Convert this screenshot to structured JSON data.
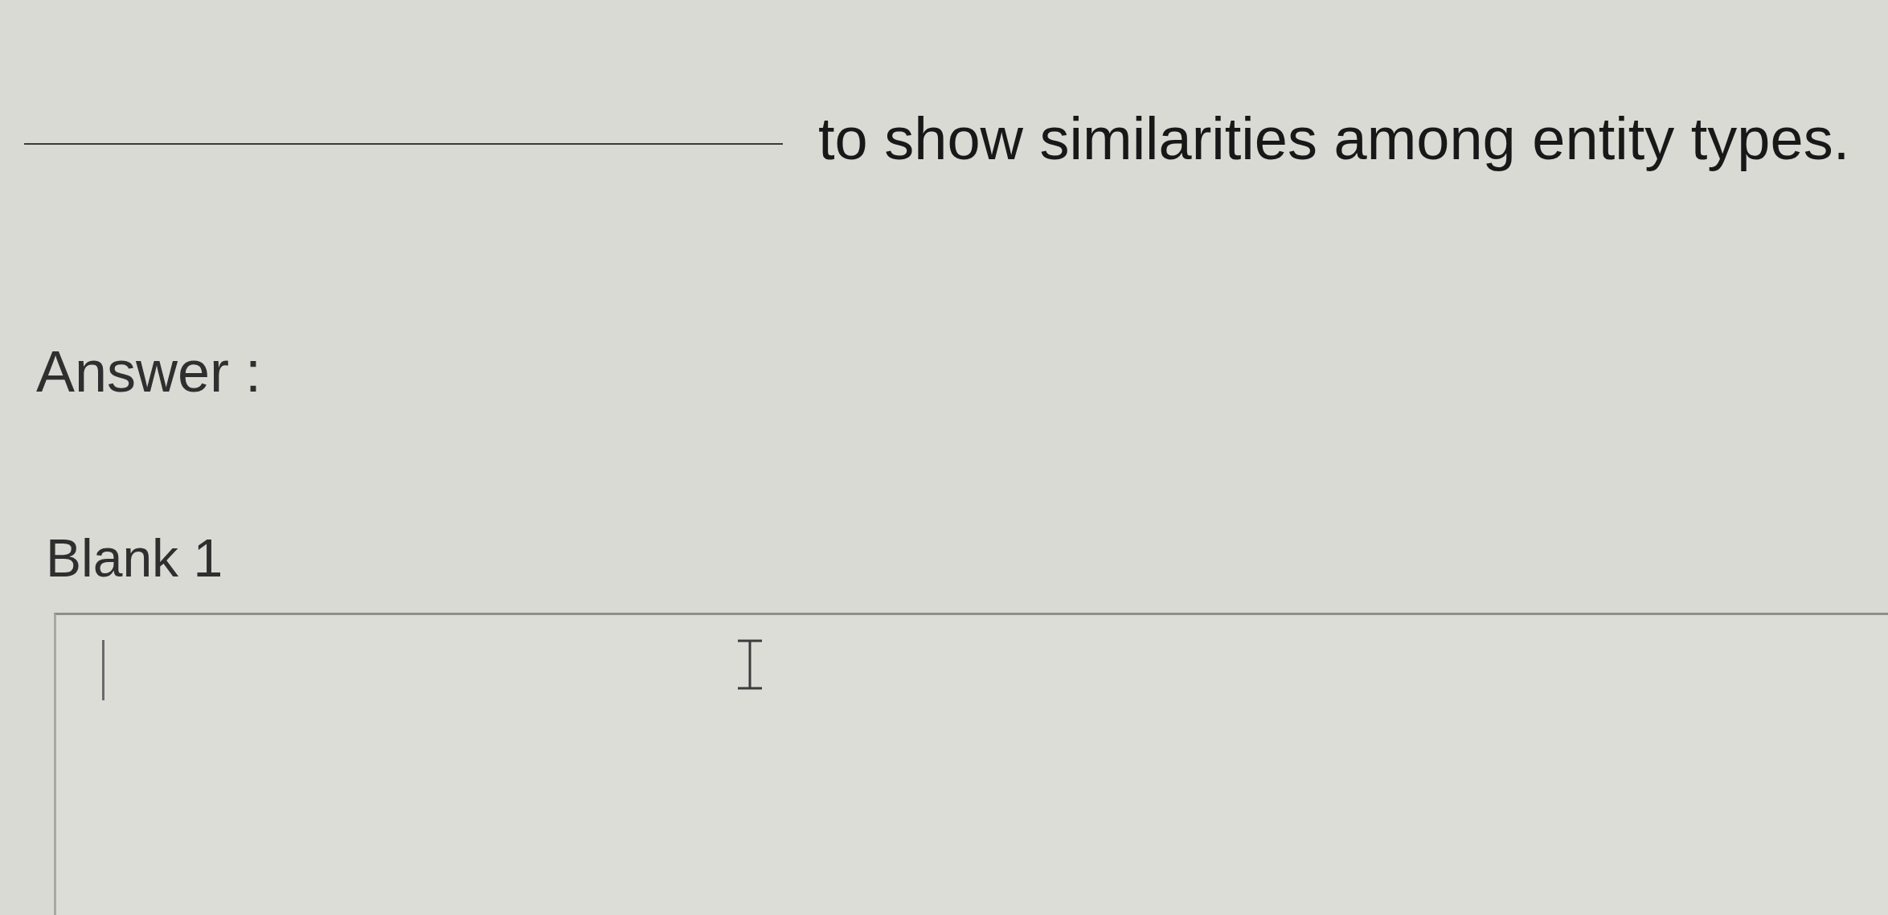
{
  "question": {
    "parts": [
      {
        "kind": "blank"
      },
      {
        "kind": "text",
        "text": "to show similarities among entity types."
      }
    ]
  },
  "answer_label": "Answer :",
  "blanks": [
    {
      "label": "Blank 1",
      "focused": true
    }
  ]
}
